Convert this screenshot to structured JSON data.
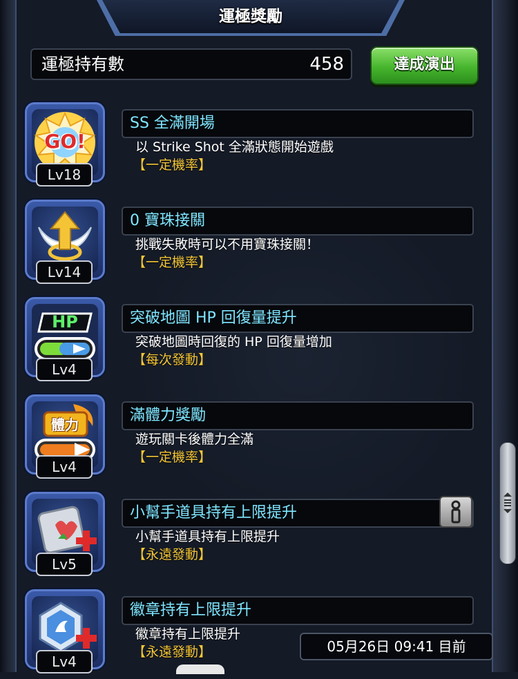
{
  "header": {
    "title": "運極獎勵"
  },
  "luck_count": {
    "label": "運極持有數",
    "value": "458"
  },
  "achieve_button": {
    "label": "達成演出"
  },
  "rewards": [
    {
      "icon": "go-burst-icon",
      "level": "Lv18",
      "title": "SS 全滿開場",
      "desc": "以 Strike Shot 全滿狀態開始遊戲",
      "tag": "【一定機率】"
    },
    {
      "icon": "winged-orb-icon",
      "level": "Lv14",
      "title": "0 寶珠接關",
      "desc": "挑戰失敗時可以不用寶珠接關！",
      "tag": "【一定機率】"
    },
    {
      "icon": "hp-boost-icon",
      "level": "Lv4",
      "title": "突破地圖 HP 回復量提升",
      "desc": "突破地圖時回復的 HP 回復量增加",
      "tag": "【每次發動】"
    },
    {
      "icon": "stamina-icon",
      "level": "Lv4",
      "title": "滿體力獎勵",
      "desc": "遊玩關卡後體力全滿",
      "tag": "【一定機率】"
    },
    {
      "icon": "helper-item-icon",
      "level": "Lv5",
      "title": "小幫手道具持有上限提升",
      "desc": "小幫手道具持有上限提升",
      "tag": "【永遠發動】"
    },
    {
      "icon": "badge-plus-icon",
      "level": "Lv4",
      "title": "徽章持有上限提升",
      "desc": "徽章持有上限提升",
      "tag": "【永遠發動】"
    }
  ],
  "icon_texts": {
    "go": "GO!",
    "hp": "HP",
    "stamina": "體力"
  },
  "timestamp": "05月26日 09:41 目前",
  "colors": {
    "title_cyan": "#7fe6ff",
    "tag_gold": "#f3c638",
    "button_green": "#46b52d"
  }
}
